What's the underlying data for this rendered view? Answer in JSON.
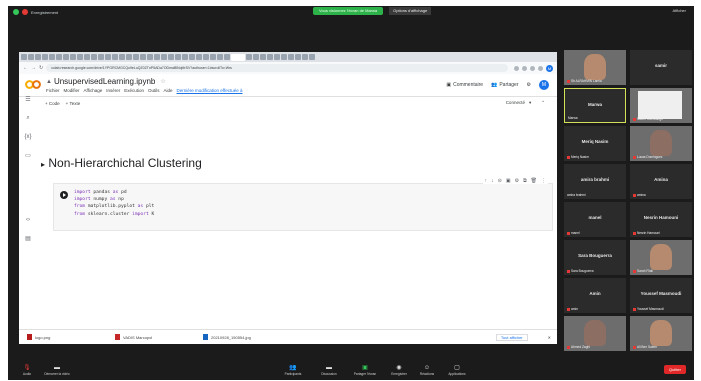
{
  "zoom": {
    "top_label": "Enregistrement",
    "share_banner": "Vous visionnez l'écran de Marwa",
    "share_options": "Options d'affichage",
    "view_button": "Afficher"
  },
  "browser": {
    "url": "colab.research.google.com/drive/1YPGRCMGCQo9eLuQZ0ZTnP5ADa7ODmaBlNqMrSV?authuser=1#scrollTo=Wrs"
  },
  "colab": {
    "title": "UnsupervisedLearning.ipynb",
    "menu": [
      "Fichier",
      "Modifier",
      "Affichage",
      "Insérer",
      "Exécution",
      "Outils",
      "Aide"
    ],
    "last_saved": "Dernière modification effectuée à",
    "comment_label": "Commentaire",
    "share_label": "Partager",
    "avatar_letter": "M",
    "toolbar_code": "+ Code",
    "toolbar_text": "+ Texte",
    "connected_label": "Connecté",
    "section_title": "Non-Hierarchichal Clustering",
    "code_lines": [
      {
        "kw1": "import",
        "rest": " pandas ",
        "kw2": "as",
        "tail": " pd"
      },
      {
        "kw1": "import",
        "rest": " numpy ",
        "kw2": "as",
        "tail": " np"
      },
      {
        "kw1": "from",
        "rest": " matplotlib.pyplot ",
        "kw2": "as",
        "tail": " plt"
      },
      {
        "kw1": "from",
        "rest": " sklearn.cluster ",
        "kw2": "import",
        "tail": " K"
      }
    ]
  },
  "downloads": {
    "items": [
      {
        "name": "logo.png",
        "type": "img"
      },
      {
        "name": "VADIS Marcopol",
        "type": "pdf"
      },
      {
        "name": "20210928_150554.jpg",
        "type": "doc"
      }
    ],
    "show_all": "Tout afficher"
  },
  "participants": [
    {
      "name": "",
      "caption": "Sh ALRAHMIN Lamia",
      "kind": "photo"
    },
    {
      "name": "samir",
      "caption": "",
      "kind": "name"
    },
    {
      "name": "Marwa",
      "caption": "Marwa",
      "kind": "highlight"
    },
    {
      "name": "",
      "caption": "Salem Ouédraogo",
      "kind": "doc"
    },
    {
      "name": "Meriq Nasim",
      "caption": "Meriq Nasim",
      "kind": "name"
    },
    {
      "name": "",
      "caption": "Lucas Dominguez",
      "kind": "photo"
    },
    {
      "name": "amira brahmi",
      "caption": "amira brahmi",
      "kind": "name"
    },
    {
      "name": "Amina",
      "caption": "amina",
      "kind": "name"
    },
    {
      "name": "manel",
      "caption": "manel",
      "kind": "name"
    },
    {
      "name": "Nesrin Hamouni",
      "caption": "Nesrin Hamouni",
      "kind": "name"
    },
    {
      "name": "Sara Bouguerra",
      "caption": "Sara Bouguerra",
      "kind": "name"
    },
    {
      "name": "",
      "caption": "Sarah Filali",
      "kind": "photo"
    },
    {
      "name": "Amin",
      "caption": "amin",
      "kind": "name"
    },
    {
      "name": "Youssef Masmoudi",
      "caption": "Youssef Masmoudi",
      "kind": "name"
    },
    {
      "name": "",
      "caption": "Ahmed Zaghi",
      "kind": "photo"
    },
    {
      "name": "",
      "caption": "Ali Ben Salem",
      "kind": "photo"
    }
  ],
  "zoom_controls": [
    {
      "label": "Audio",
      "icon": "mic-icon"
    },
    {
      "label": "Démarrer la vidéo",
      "icon": "video-icon"
    },
    {
      "label": "Participants",
      "icon": "participants-icon"
    },
    {
      "label": "Discussion",
      "icon": "chat-icon"
    },
    {
      "label": "Partager l'écran",
      "icon": "share-screen-icon"
    },
    {
      "label": "Enregistrer",
      "icon": "record-icon"
    },
    {
      "label": "Réactions",
      "icon": "reactions-icon"
    },
    {
      "label": "Applications",
      "icon": "apps-icon"
    }
  ],
  "end_label": "Quitter",
  "colors": {
    "zoom_green": "#2db34a",
    "colab_orange": "#f9ab00",
    "highlight_border": "#d4e157",
    "end_red": "#e02828"
  }
}
